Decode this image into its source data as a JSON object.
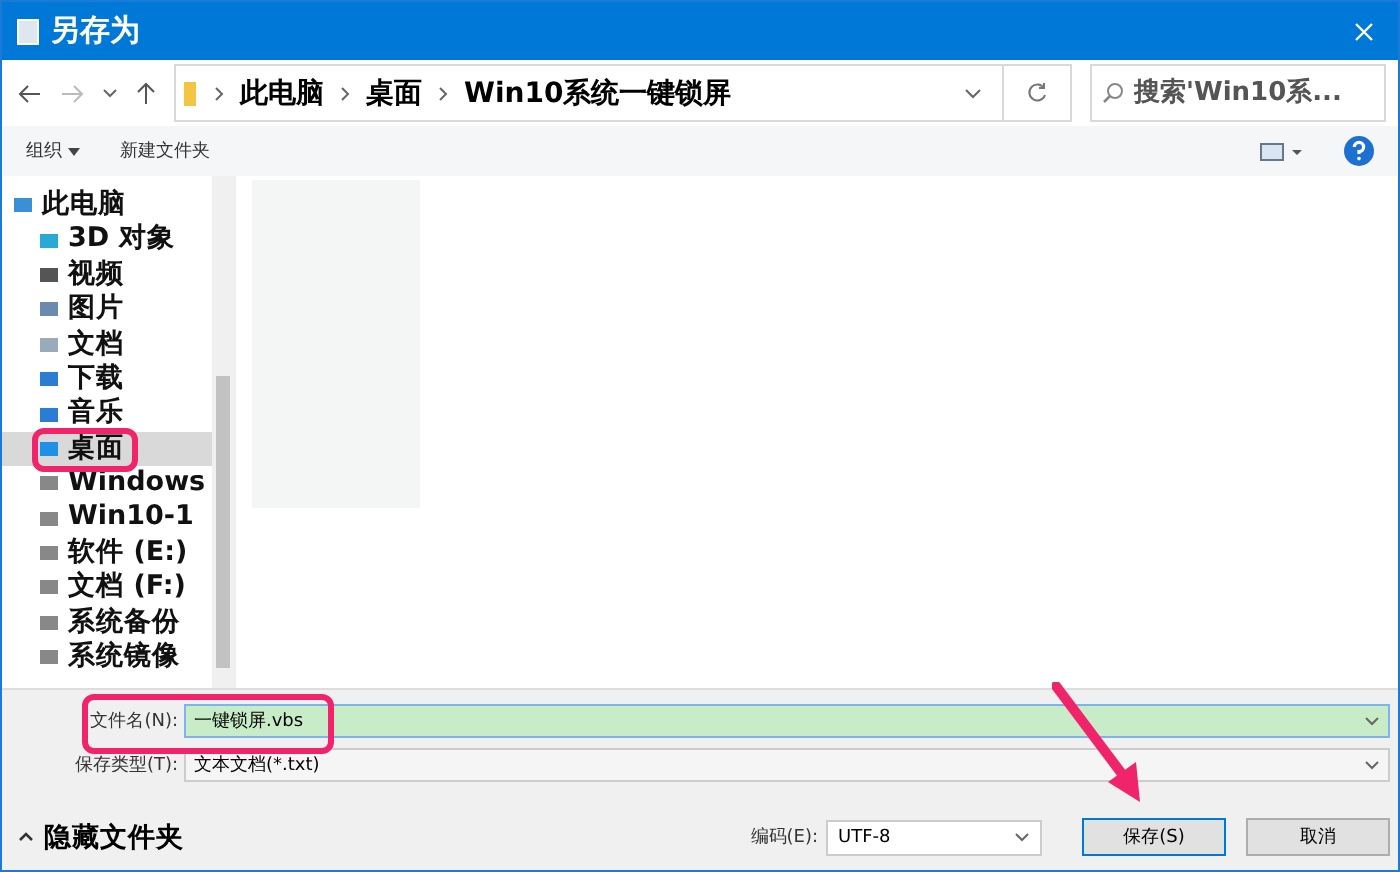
{
  "window": {
    "title": "另存为"
  },
  "address_bar": {
    "segments": [
      "此电脑",
      "桌面",
      "Win10系统一键锁屏"
    ]
  },
  "search": {
    "placeholder": "搜索'Win10系..."
  },
  "toolbar": {
    "organize": "组织",
    "new_folder": "新建文件夹"
  },
  "sidebar": {
    "items": [
      {
        "label": "此电脑",
        "selected": false,
        "children": [
          {
            "label": "3D 对象",
            "selected": false
          },
          {
            "label": "视频",
            "selected": false
          },
          {
            "label": "图片",
            "selected": false
          },
          {
            "label": "文档",
            "selected": false
          },
          {
            "label": "下载",
            "selected": false
          },
          {
            "label": "音乐",
            "selected": false
          },
          {
            "label": "桌面",
            "selected": true
          },
          {
            "label": "Windows",
            "selected": false
          },
          {
            "label": "Win10-1",
            "selected": false
          },
          {
            "label": "软件 (E:)",
            "selected": false
          },
          {
            "label": "文档 (F:)",
            "selected": false
          },
          {
            "label": "系统备份",
            "selected": false
          },
          {
            "label": "系统镜像",
            "selected": false
          }
        ]
      }
    ]
  },
  "form": {
    "filename_label": "文件名(N):",
    "filename": "一键锁屏.vbs",
    "type_label": "保存类型(T):",
    "type": "文本文档(*.txt)"
  },
  "footer": {
    "hide_folders": "隐藏文件夹",
    "encoding_label": "编码(E):",
    "encoding": "UTF-8",
    "buttons": [
      "保存(S)",
      "取消"
    ]
  }
}
